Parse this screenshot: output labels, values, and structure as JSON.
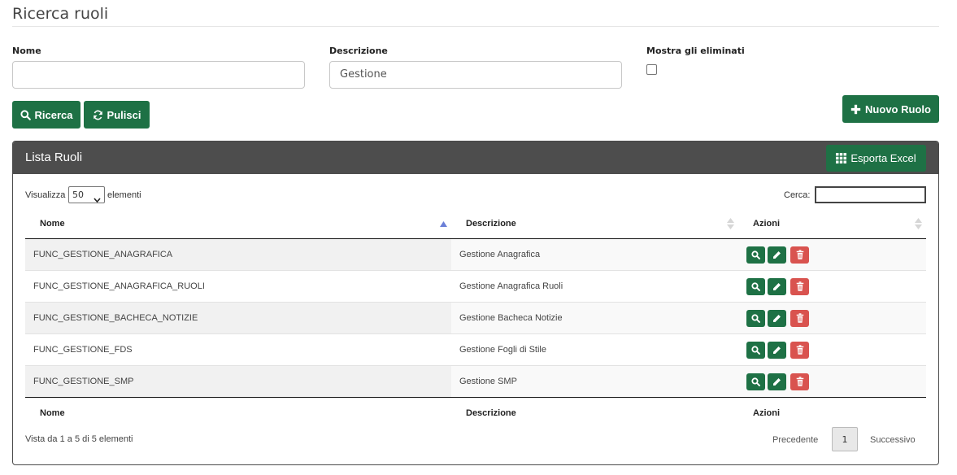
{
  "page": {
    "title": "Ricerca ruoli"
  },
  "filters": {
    "nome_label": "Nome",
    "nome_value": "",
    "descrizione_label": "Descrizione",
    "descrizione_value": "Gestione",
    "deleted_label": "Mostra gli eliminati",
    "deleted_checked": false
  },
  "actions": {
    "search_label": "Ricerca",
    "clear_label": "Pulisci",
    "new_label": "Nuovo Ruolo"
  },
  "panel": {
    "title": "Lista Ruoli",
    "export_label": "Esporta Excel"
  },
  "table_controls": {
    "length_prefix": "Visualizza",
    "length_value": "50",
    "length_suffix": "elementi",
    "search_label": "Cerca:",
    "search_value": ""
  },
  "table": {
    "headers": [
      "Nome",
      "Descrizione",
      "Azioni"
    ],
    "rows": [
      {
        "nome": "FUNC_GESTIONE_ANAGRAFICA",
        "descrizione": "Gestione Anagrafica"
      },
      {
        "nome": "FUNC_GESTIONE_ANAGRAFICA_RUOLI",
        "descrizione": "Gestione Anagrafica Ruoli"
      },
      {
        "nome": "FUNC_GESTIONE_BACHECA_NOTIZIE",
        "descrizione": "Gestione Bacheca Notizie"
      },
      {
        "nome": "FUNC_GESTIONE_FDS",
        "descrizione": "Gestione Fogli di Stile"
      },
      {
        "nome": "FUNC_GESTIONE_SMP",
        "descrizione": "Gestione SMP"
      }
    ],
    "footers": [
      "Nome",
      "Descrizione",
      "Azioni"
    ]
  },
  "footer": {
    "info": "Vista da 1 a 5 di 5 elementi",
    "prev_label": "Precedente",
    "current_page": "1",
    "next_label": "Successivo"
  },
  "colors": {
    "primary_green": "#1e7145",
    "danger_red": "#d9534f",
    "panel_header": "#4d4d4d"
  },
  "icons": {
    "search_button": "search-icon",
    "clear_button": "refresh-icon",
    "new_button": "plus-icon",
    "export_button": "grid-icon",
    "row_view": "search-icon",
    "row_edit": "pencil-icon",
    "row_delete": "trash-icon"
  }
}
